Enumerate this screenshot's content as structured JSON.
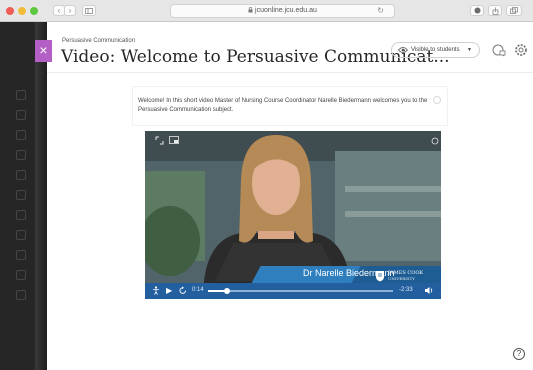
{
  "browser": {
    "url": "jcuonline.jcu.edu.au",
    "traffic_colors": [
      "#ee5c54",
      "#f3bd3c",
      "#5ec842"
    ],
    "back_glyph": "‹",
    "forward_glyph": "›"
  },
  "panel": {
    "close_glyph": "×",
    "accent": "#b45fc5",
    "breadcrumb": "Persuasive Communication",
    "title": "Video: Welcome to Persuasive Communicat...",
    "visibility": "Visible to students",
    "visibility_caret": "▼"
  },
  "content": {
    "description": "Welcome! In this short video Master of Nursing Course Coordinator Narelle Biedermann welcomes you to the Persuasive Communication subject."
  },
  "video": {
    "speaker_name": "Dr Narelle Biedermann",
    "logo_text": "JAMES COOK",
    "logo_sub": "UNIVERSITY",
    "brand_color": "#235f9f",
    "elapsed": "0:14",
    "remaining": "-2:33",
    "progress": 0.1,
    "play_glyph": "▶"
  },
  "help_glyph": "?"
}
